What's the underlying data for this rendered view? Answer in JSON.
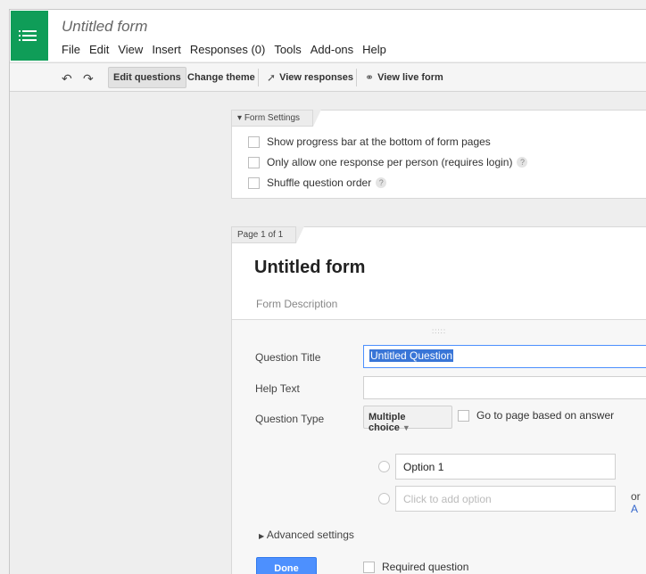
{
  "header": {
    "doc_title": "Untitled form",
    "menu": [
      "File",
      "Edit",
      "View",
      "Insert",
      "Responses (0)",
      "Tools",
      "Add-ons",
      "Help"
    ]
  },
  "toolbar": {
    "edit_questions": "Edit questions",
    "change_theme": "Change theme",
    "view_responses": "View responses",
    "view_live_form": "View live form"
  },
  "settings": {
    "tab_label": "Form Settings",
    "progress_bar": "Show progress bar at the bottom of form pages",
    "one_response": "Only allow one response per person (requires login)",
    "shuffle": "Shuffle question order"
  },
  "form": {
    "page_label": "Page 1 of 1",
    "title": "Untitled form",
    "description_placeholder": "Form Description"
  },
  "question": {
    "title_label": "Question Title",
    "title_value": "Untitled Question",
    "help_label": "Help Text",
    "type_label": "Question Type",
    "type_value": "Multiple choice",
    "goto_page": "Go to page based on answer",
    "option1": "Option 1",
    "add_option_placeholder": "Click to add option",
    "or_text": "or",
    "or_link": "A",
    "advanced": "Advanced settings",
    "done": "Done",
    "required": "Required question"
  },
  "colors": {
    "brand_green": "#0f9d58",
    "primary_blue": "#4d90fe"
  }
}
